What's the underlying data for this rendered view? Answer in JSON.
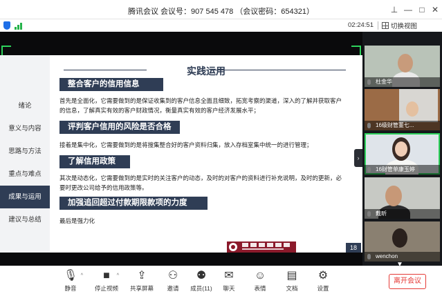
{
  "window": {
    "title": "腾讯会议  会议号：907 545 478  （会议密码：654321）",
    "controls": [
      "pin",
      "minimize",
      "maximize",
      "close"
    ]
  },
  "status": {
    "timer": "02:24:51",
    "switch_view_label": "切换视图",
    "shield_icon": "shield-icon",
    "signal_icon": "signal-icon",
    "colors": {
      "shield": "#1e6fe8",
      "signal": "#25b34a"
    }
  },
  "slide": {
    "heading": "实践运用",
    "nav": [
      {
        "label": "绪论",
        "active": false
      },
      {
        "label": "意义与内容",
        "active": false
      },
      {
        "label": "思路与方法",
        "active": false
      },
      {
        "label": "重点与难点",
        "active": false
      },
      {
        "label": "成果与运用",
        "active": true
      },
      {
        "label": "建议与总结",
        "active": false
      }
    ],
    "sections": [
      {
        "title": "整合客户的信用信息",
        "text": "首先是全面化，它需要做到的是保证收集到的客户信息全面且细致，拓宽考察的渠道，深入的了解并获取客户的信息，了解真实有效的客户财政情况，衡量真实有效的客户经济发展水平；"
      },
      {
        "title": "评判客户信用的风险是否合格",
        "text": "接着是集中化，它需要做到的是将搜集整合好的客户资料归集，放入存档室集中统一的进行管理；"
      },
      {
        "title": "了解信用政策",
        "text": "其次是动态化，它需要做到的是实时的关注客户的动态，及时的对客户的资料进行补充说明，及时的更新，必要时更改公司给予的信用政策等。"
      },
      {
        "title": "加强追回超过付款期限款项的力度",
        "text": "最后是强力化"
      }
    ],
    "page_number": "18",
    "theme_color": "#2f3d55",
    "logo_color": "#8b1a2b"
  },
  "participants": [
    {
      "name": "杜金华",
      "muted": false
    },
    {
      "name": "16级财管董七...",
      "muted": false
    },
    {
      "name": "16财管单康玉婷",
      "muted": false,
      "active": true
    },
    {
      "name": "戴昕",
      "muted": false
    },
    {
      "name": "wenchon",
      "muted": false
    }
  ],
  "toolbar": {
    "items": [
      {
        "label": "静音",
        "icon": "microphone-icon"
      },
      {
        "label": "停止视频",
        "icon": "video-camera-icon"
      },
      {
        "label": "共享屏幕",
        "icon": "share-screen-icon"
      },
      {
        "label": "邀请",
        "icon": "invite-user-icon"
      },
      {
        "label": "成员(11)",
        "icon": "members-icon"
      },
      {
        "label": "聊天",
        "icon": "chat-icon"
      },
      {
        "label": "表情",
        "icon": "emoji-icon"
      },
      {
        "label": "文档",
        "icon": "document-icon"
      },
      {
        "label": "设置",
        "icon": "settings-icon"
      }
    ],
    "leave_label": "离开会议",
    "leave_color": "#e53935"
  }
}
